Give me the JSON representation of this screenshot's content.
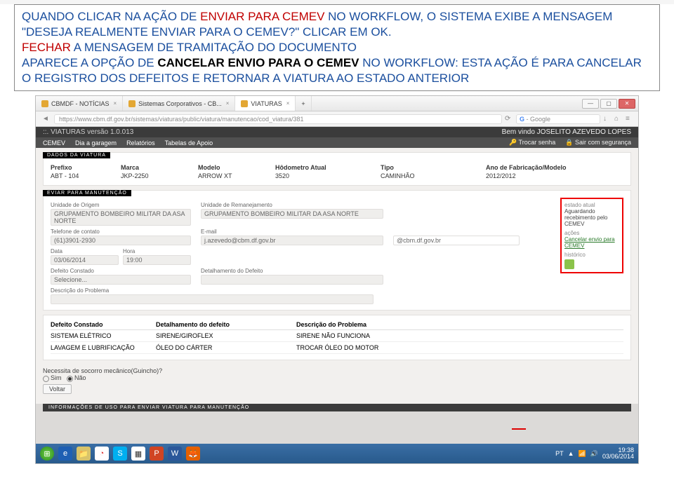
{
  "instruction": {
    "line1a": "QUANDO CLICAR NA AÇÃO DE ",
    "line1b": "ENVIAR PARA CEMEV",
    "line1c": " NO WORKFLOW, O SISTEMA EXIBE A MENSAGEM \"DESEJA REALMENTE ENVIAR PARA O CEMEV?\" CLICAR EM OK.",
    "line2a": "FECHAR",
    "line2b": " A MENSAGEM DE TRAMITAÇÃO DO DOCUMENTO",
    "line3a": "APARECE A OPÇÃO DE ",
    "line3b": "CANCELAR ENVIO PARA O CEMEV",
    "line3c": " NO WORKFLOW: ESTA AÇÃO É PARA CANCELAR O REGISTRO DOS DEFEITOS E RETORNAR A VIATURA AO ESTADO ANTERIOR"
  },
  "browser": {
    "tabs": [
      "CBMDF - NOTÍCIAS",
      "Sistemas Corporativos - CB...",
      "VIATURAS"
    ],
    "url": "https://www.cbm.df.gov.br/sistemas/viaturas/public/viatura/manutencao/cod_viatura/381",
    "search": "Google"
  },
  "app": {
    "title": "::. VIATURAS versão 1.0.013",
    "welcome": "Bem vindo JOSELITO AZEVEDO LOPES",
    "menu": [
      "CEMEV",
      "Dia a garagem",
      "Relatórios",
      "Tabelas de Apoio"
    ],
    "menuRight": [
      "Trocar senha",
      "Sair com segurança"
    ]
  },
  "dados": {
    "label": "DADOS DA VIATURA",
    "headers": [
      "Prefixo",
      "Marca",
      "Modelo",
      "Hôdometro Atual",
      "Tipo",
      "Ano de Fabricação/Modelo"
    ],
    "values": [
      "ABT - 104",
      "JKP-2250",
      "ARROW XT",
      "3520",
      "CAMINHÃO",
      "2012/2012"
    ]
  },
  "envio": {
    "label": "EVIAR PARA MANUTENÇÃO",
    "unidOrigem": {
      "label": "Unidade de Origem",
      "val": "GRUPAMENTO BOMBEIRO MILITAR DA ASA NORTE"
    },
    "unidRem": {
      "label": "Unidade de Remanejamento",
      "val": "GRUPAMENTO BOMBEIRO MILITAR DA ASA NORTE"
    },
    "tel": {
      "label": "Telefone de contato",
      "val": "(61)3901-2930"
    },
    "email": {
      "label": "E-mail",
      "val": "j.azevedo@cbm.df.gov.br"
    },
    "domain": "@cbm.df.gov.br",
    "data": {
      "label": "Data",
      "val": "03/06/2014"
    },
    "hora": {
      "label": "Hora",
      "val": "19:00"
    },
    "defeito": {
      "label": "Defeito Constado",
      "val": "Selecione..."
    },
    "detalhe": {
      "label": "Detalhamento do Defeito"
    },
    "descricao": {
      "label": "Descrição do Problema"
    }
  },
  "actions": {
    "estadoLabel": "estado atual",
    "estado": "Aguardando recebimento pelo CEMEV",
    "acoesLabel": "ações",
    "cancelar": "Cancelar envio para CEMEV",
    "historicoLabel": "histórico"
  },
  "defTable": {
    "headers": [
      "Defeito Constado",
      "Detalhamento do defeito",
      "Descrição do Problema"
    ],
    "rows": [
      [
        "SISTEMA ELÉTRICO",
        "SIRENE/GIROFLEX",
        "SIRENE NÃO FUNCIONA"
      ],
      [
        "LAVAGEM E LUBRIFICAÇÃO",
        "ÓLEO DO CÁRTER",
        "TROCAR ÓLEO DO MOTOR"
      ]
    ]
  },
  "socorro": {
    "label": "Necessita de socorro mecânico(Guincho)?",
    "sim": "Sim",
    "nao": "Não",
    "voltar": "Voltar"
  },
  "infoBar": "INFORMAÇÕES DE USO PARA ENVIAR VIATURA PARA MANUTENÇÃO",
  "taskbar": {
    "lang": "PT",
    "time": "19:38",
    "date": "03/06/2014"
  }
}
